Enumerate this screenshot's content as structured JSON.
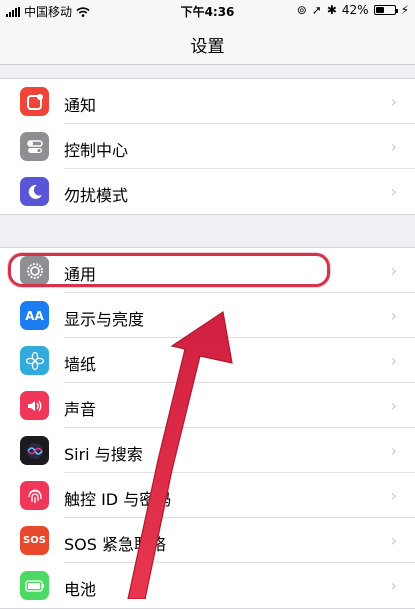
{
  "status_bar": {
    "carrier": "中国移动",
    "time": "下午4:36",
    "battery": "42%",
    "battery_level": 0.42
  },
  "nav": {
    "title": "设置"
  },
  "groups": [
    {
      "items": [
        {
          "label": "通知",
          "icon": "notifications-icon",
          "color": "#f04438"
        },
        {
          "label": "控制中心",
          "icon": "control-center-icon",
          "color": "#8e8e93"
        },
        {
          "label": "勿扰模式",
          "icon": "do-not-disturb-icon",
          "color": "#5856d6"
        }
      ]
    },
    {
      "items": [
        {
          "label": "通用",
          "icon": "gear-icon",
          "color": "#8e8e93"
        },
        {
          "label": "显示与亮度",
          "icon": "display-brightness-icon",
          "color": "#1c7cf2",
          "glyph": "AA"
        },
        {
          "label": "墙纸",
          "icon": "wallpaper-icon",
          "color": "#33aadc"
        },
        {
          "label": "声音",
          "icon": "sound-icon",
          "color": "#f0375a"
        },
        {
          "label": "Siri 与搜索",
          "icon": "siri-icon",
          "color": "#1b1b1f"
        },
        {
          "label": "触控 ID 与密码",
          "icon": "touch-id-icon",
          "color": "#f0375a"
        },
        {
          "label": "SOS 紧急联络",
          "icon": "sos-icon",
          "color": "#e8492c",
          "glyph": "SOS"
        },
        {
          "label": "电池",
          "icon": "battery-icon",
          "color": "#4cd964"
        }
      ]
    }
  ],
  "annotation": {
    "highlight_color": "#d1344c",
    "arrow_color": "#e8364e"
  }
}
